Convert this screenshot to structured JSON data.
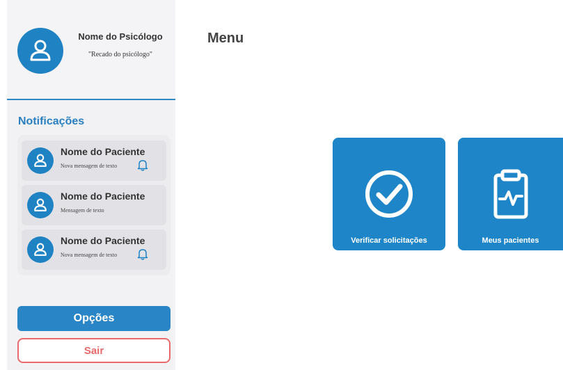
{
  "psychologist": {
    "name": "Nome do Psicólogo",
    "message": "\"Recado do psicólogo\""
  },
  "notifications": {
    "title": "Notificações",
    "items": [
      {
        "name": "Nome do Paciente",
        "message": "Nova mensagem de texto",
        "bell": true
      },
      {
        "name": "Nome do Paciente",
        "message": "Mensagem de texto",
        "bell": false
      },
      {
        "name": "Nome do Paciente",
        "message": "Nova mensagem de texto",
        "bell": true
      }
    ]
  },
  "buttons": {
    "options": "Opções",
    "exit": "Sair"
  },
  "main": {
    "title": "Menu",
    "tiles": [
      {
        "label": "Verificar solicitações",
        "icon": "check-circle-icon"
      },
      {
        "label": "Meus pacientes",
        "icon": "clipboard-pulse-icon"
      }
    ]
  },
  "colors": {
    "primary": "#1f82c3",
    "danger": "#e86a6a",
    "sidebar_bg": "#f2f2f4"
  }
}
